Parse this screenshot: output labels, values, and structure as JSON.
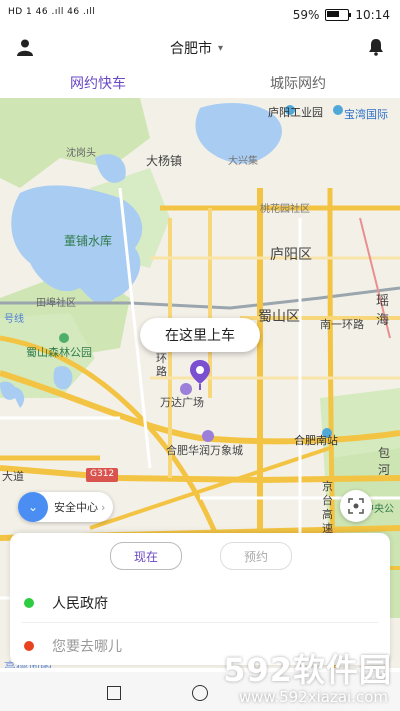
{
  "status_bar": {
    "left_text": "HD 1 46 .ıll 46 .ıll",
    "battery": "59%",
    "time": "10:14"
  },
  "header": {
    "city": "合肥市",
    "user_icon": "user-icon",
    "bell_icon": "bell-icon"
  },
  "tabs": [
    {
      "label": "网约快车",
      "active": true
    },
    {
      "label": "城际网约",
      "active": false
    }
  ],
  "map": {
    "labels": [
      {
        "text": "庐阳工业园"
      },
      {
        "text": "宝湾国际"
      },
      {
        "text": "沈岗头"
      },
      {
        "text": "大杨镇"
      },
      {
        "text": "大兴集"
      },
      {
        "text": "桃花园社区"
      },
      {
        "text": "董铺水库"
      },
      {
        "text": "庐阳区"
      },
      {
        "text": "田埠社区"
      },
      {
        "text": "号线"
      },
      {
        "text": "蜀山区"
      },
      {
        "text": "南一环路"
      },
      {
        "text": "瑶海"
      },
      {
        "text": "蜀山森林公园"
      },
      {
        "text": "环路"
      },
      {
        "text": "万达广场"
      },
      {
        "text": "合肥华润万象城"
      },
      {
        "text": "合肥南站"
      },
      {
        "text": "包河"
      },
      {
        "text": "大道"
      },
      {
        "text": "G312"
      },
      {
        "text": "京台高速"
      },
      {
        "text": "中央公"
      }
    ],
    "pickup_label": "在这里上车",
    "safety_label": "安全中心"
  },
  "card": {
    "now_label": "现在",
    "book_label": "预约",
    "origin": "人民政府",
    "destination_placeholder": "您要去哪儿",
    "origin_color": "#2ecc40",
    "destination_color": "#e8431f"
  },
  "watermark": {
    "main": "592软件园",
    "sub": "www.592xiazai.com"
  },
  "amap_logo": "高德地图",
  "accent_color": "#6a48c4"
}
